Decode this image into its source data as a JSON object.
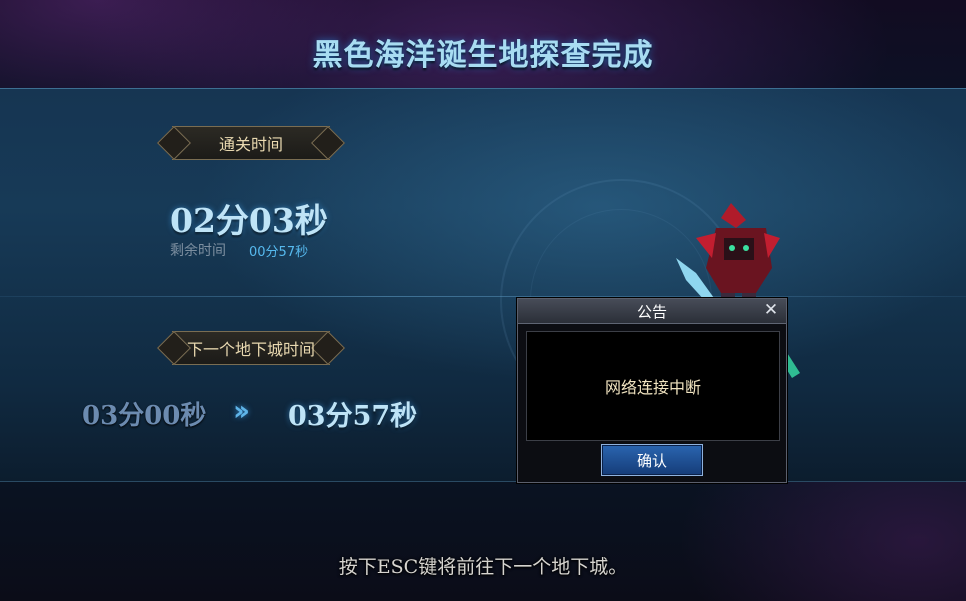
{
  "header": {
    "title": "黑色海洋诞生地探查完成"
  },
  "clear_time": {
    "tag_label": "通关时间",
    "time": "02分03秒",
    "remaining_label": "剩余时间",
    "remaining_value": "00分57秒"
  },
  "next_dungeon": {
    "tag_label": "下一个地下城时间",
    "from_time": "03分00秒",
    "arrow": "››",
    "to_time": "03分57秒"
  },
  "footer": {
    "prompt": "按下ESC键将前往下一个地下城。"
  },
  "dialog": {
    "title": "公告",
    "close_symbol": "✕",
    "message": "网络连接中断",
    "confirm_label": "确认"
  },
  "colors": {
    "title": "#a8dcf2",
    "time_big": "#bfe4f7",
    "remaining_value": "#56b9ee",
    "dialog_button": "#1f4f95"
  }
}
